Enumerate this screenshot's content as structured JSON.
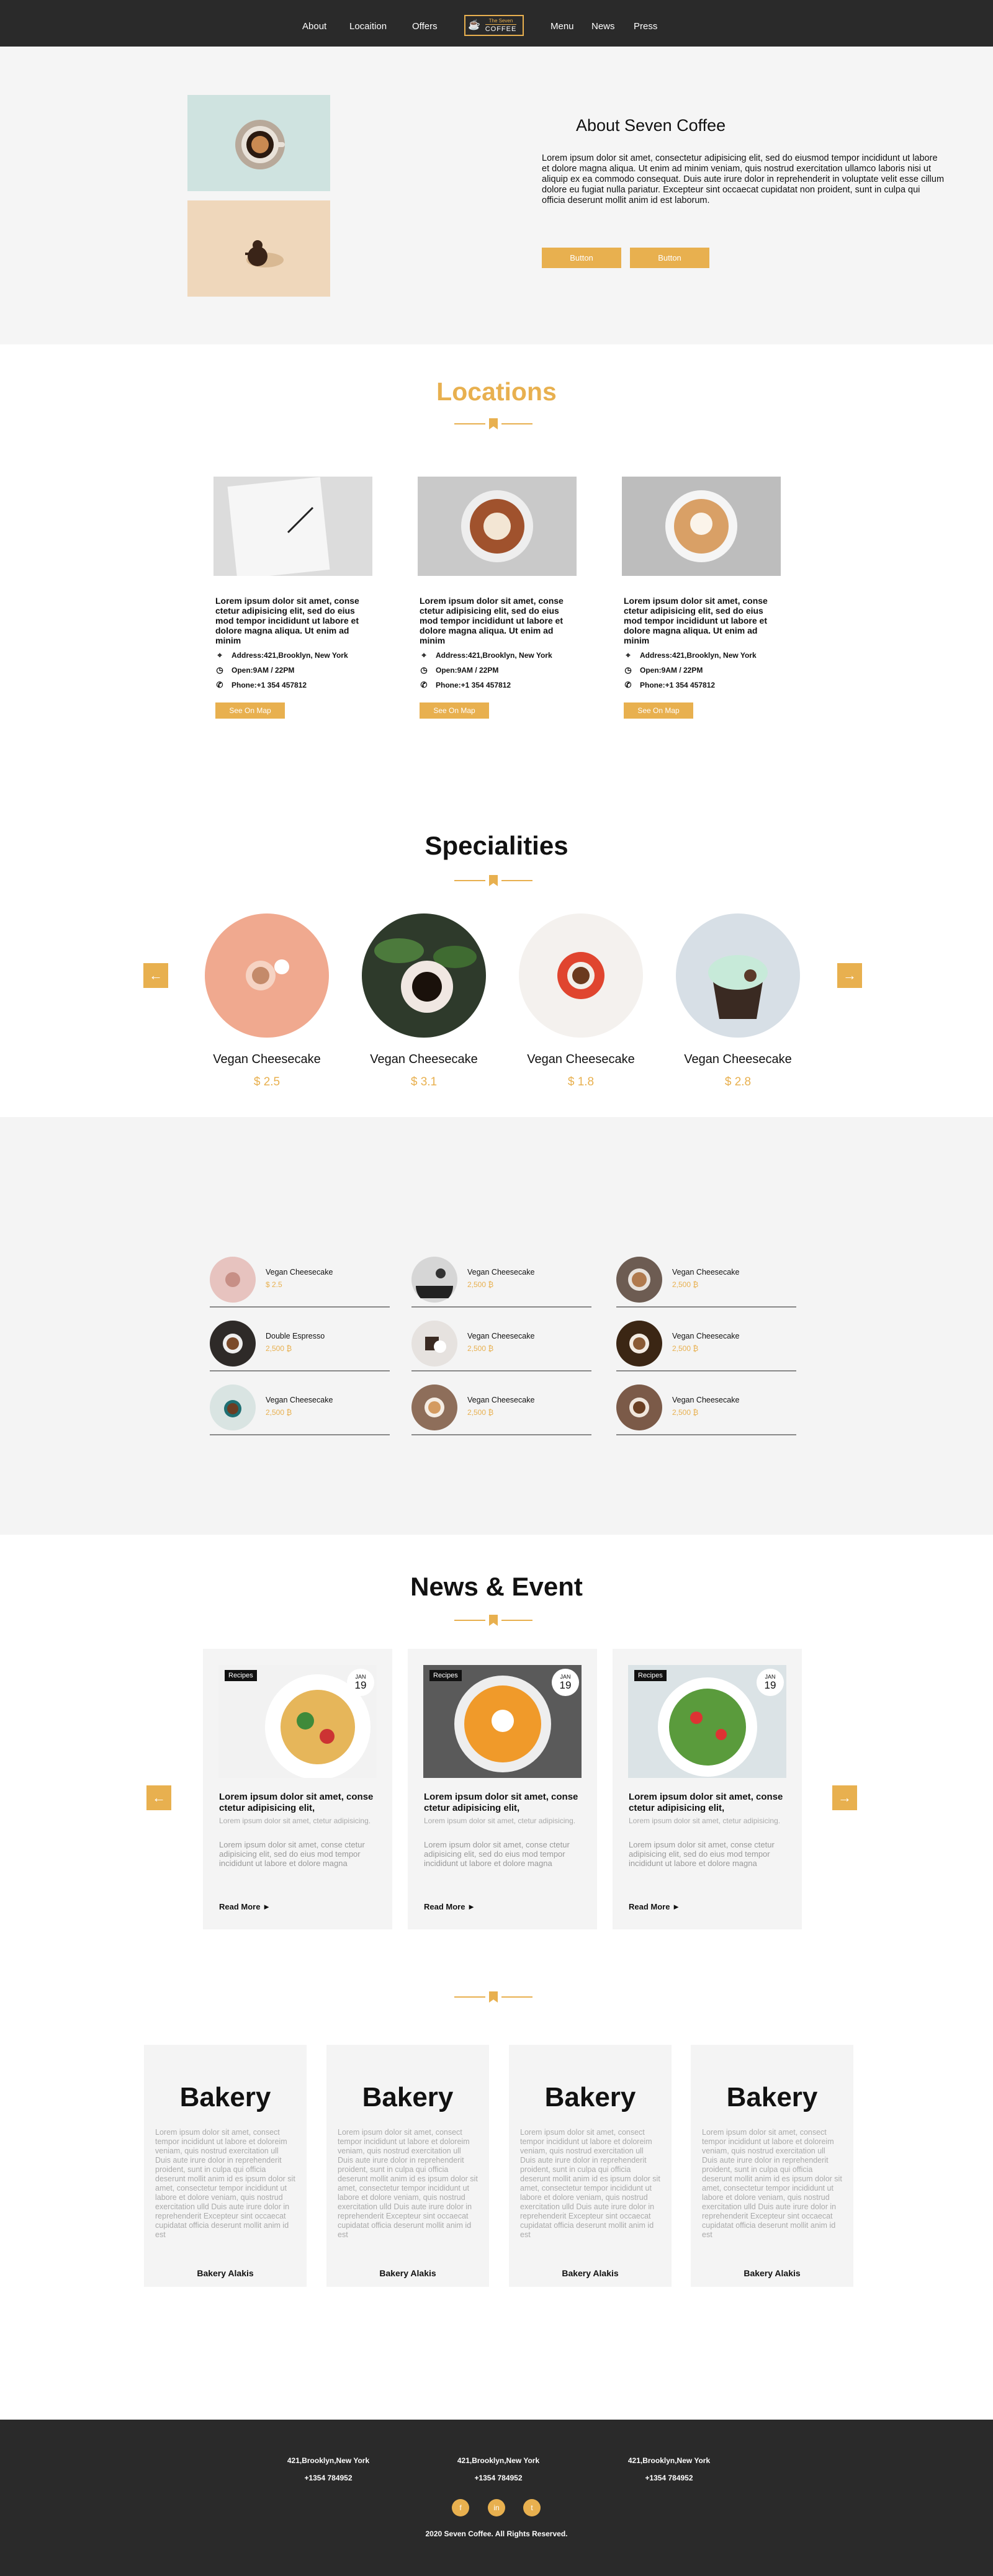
{
  "nav": {
    "links": [
      "About",
      "Locaition",
      "Offers",
      "Menu",
      "News",
      "Press"
    ],
    "logo_top": "The Seven",
    "logo_bottom": "COFFEE"
  },
  "about": {
    "title": "About Seven Coffee",
    "text": "Lorem ipsum dolor sit amet, consectetur adipisicing elit, sed do eiusmod tempor incididunt ut labore et dolore magna aliqua. Ut enim ad minim veniam, quis nostrud exercitation ullamco laboris nisi ut aliquip ex ea commodo consequat. Duis aute irure dolor in reprehenderit in voluptate velit esse cillum dolore eu fugiat nulla pariatur. Excepteur sint occaecat cupidatat non proident, sunt in culpa qui officia deserunt mollit anim id est laborum.",
    "button1": "Button",
    "button2": "Button"
  },
  "locations": {
    "title": "Locations",
    "cards": [
      {
        "desc": "Lorem ipsum dolor sit amet, conse ctetur adipisicing elit, sed do eius mod tempor incididunt ut labore  et dolore magna  aliqua. Ut enim ad minim",
        "address": "Address:421,Brooklyn, New York",
        "open": "Open:9AM / 22PM",
        "phone": "Phone:+1 354 457812",
        "map": "See On Map"
      },
      {
        "desc": "Lorem ipsum dolor sit amet, conse ctetur adipisicing elit, sed do eius mod tempor incididunt ut labore  et dolore magna  aliqua. Ut enim ad minim",
        "address": "Address:421,Brooklyn, New York",
        "open": "Open:9AM / 22PM",
        "phone": "Phone:+1 354 457812",
        "map": "See On Map"
      },
      {
        "desc": "Lorem ipsum dolor sit amet, conse ctetur adipisicing elit, sed do eius mod tempor incididunt ut labore  et dolore magna  aliqua. Ut enim ad minim",
        "address": "Address:421,Brooklyn, New York",
        "open": "Open:9AM / 22PM",
        "phone": "Phone:+1 354 457812",
        "map": "See On Map"
      }
    ]
  },
  "specialities": {
    "title": "Specialities",
    "items": [
      {
        "name": "Vegan Cheesecake",
        "price": "$ 2.5"
      },
      {
        "name": "Vegan Cheesecake",
        "price": "$ 3.1"
      },
      {
        "name": "Vegan Cheesecake",
        "price": "$ 1.8"
      },
      {
        "name": "Vegan Cheesecake",
        "price": "$ 2.8"
      }
    ]
  },
  "menu": {
    "items": [
      {
        "name": "Vegan Cheesecake",
        "price": "$ 2.5"
      },
      {
        "name": "Vegan Cheesecake",
        "price": "2,500 ₿"
      },
      {
        "name": "Vegan Cheesecake",
        "price": "2,500 ₿"
      },
      {
        "name": "Double Espresso",
        "price": "2,500 ₿"
      },
      {
        "name": "Vegan Cheesecake",
        "price": "2,500 ₿"
      },
      {
        "name": "Vegan Cheesecake",
        "price": "2,500 ₿"
      },
      {
        "name": "Vegan Cheesecake",
        "price": "2,500 ₿"
      },
      {
        "name": "Vegan Cheesecake",
        "price": "2,500 ₿"
      },
      {
        "name": "Vegan Cheesecake",
        "price": "2,500 ₿"
      }
    ]
  },
  "news": {
    "title": "News & Event",
    "cards": [
      {
        "tag": "Recipes",
        "month": "JAN",
        "day": "19",
        "heading": "Lorem ipsum dolor sit amet, conse ctetur adipisicing elit,",
        "sub": "Lorem ipsum dolor sit amet, ctetur adipisicing.",
        "body": "Lorem ipsum dolor sit amet, conse ctetur adipisicing elit, sed do eius mod tempor incididunt ut labore  et dolore magna",
        "read_more": "Read More  ►"
      },
      {
        "tag": "Recipes",
        "month": "JAN",
        "day": "19",
        "heading": "Lorem ipsum dolor sit amet, conse ctetur adipisicing elit,",
        "sub": "Lorem ipsum dolor sit amet, ctetur adipisicing.",
        "body": "Lorem ipsum dolor sit amet, conse ctetur adipisicing elit, sed do eius mod tempor incididunt ut labore  et dolore magna",
        "read_more": "Read More  ►"
      },
      {
        "tag": "Recipes",
        "month": "JAN",
        "day": "19",
        "heading": "Lorem ipsum dolor sit amet, conse ctetur adipisicing elit,",
        "sub": "Lorem ipsum dolor sit amet, ctetur adipisicing.",
        "body": "Lorem ipsum dolor sit amet, conse ctetur adipisicing elit, sed do eius mod tempor incididunt ut labore  et dolore magna",
        "read_more": "Read More  ►"
      }
    ]
  },
  "bakery": {
    "cards": [
      {
        "title": "Bakery",
        "text": "Lorem ipsum dolor sit amet, consect tempor incididunt ut labore et doloreim veniam, quis nostrud exercitation ull Duis aute irure dolor in reprehenderit proident, sunt in culpa qui officia deserunt mollit anim id es ipsum dolor sit amet, consectetur tempor incididunt ut labore et dolore veniam, quis nostrud exercitation ulld Duis aute irure dolor in reprehenderit Excepteur sint occaecat cupidatat officia deserunt mollit anim id est",
        "author": "Bakery Alakis"
      },
      {
        "title": "Bakery",
        "text": "Lorem ipsum dolor sit amet, consect tempor incididunt ut labore et doloreim veniam, quis nostrud exercitation ull Duis aute irure dolor in reprehenderit proident, sunt in culpa qui officia deserunt mollit anim id es ipsum dolor sit amet, consectetur tempor incididunt ut labore et dolore veniam, quis nostrud exercitation ulld Duis aute irure dolor in reprehenderit Excepteur sint occaecat cupidatat officia deserunt mollit anim id est",
        "author": "Bakery Alakis"
      },
      {
        "title": "Bakery",
        "text": "Lorem ipsum dolor sit amet, consect tempor incididunt ut labore et doloreim veniam, quis nostrud exercitation ull Duis aute irure dolor in reprehenderit proident, sunt in culpa qui officia deserunt mollit anim id es ipsum dolor sit amet, consectetur tempor incididunt ut labore et dolore veniam, quis nostrud exercitation ulld Duis aute irure dolor in reprehenderit Excepteur sint occaecat cupidatat officia deserunt mollit anim id est",
        "author": "Bakery Alakis"
      },
      {
        "title": "Bakery",
        "text": "Lorem ipsum dolor sit amet, consect tempor incididunt ut labore et doloreim veniam, quis nostrud exercitation ull Duis aute irure dolor in reprehenderit proident, sunt in culpa qui officia deserunt mollit anim id es ipsum dolor sit amet, consectetur tempor incididunt ut labore et dolore veniam, quis nostrud exercitation ulld Duis aute irure dolor in reprehenderit Excepteur sint occaecat cupidatat officia deserunt mollit anim id est",
        "author": "Bakery Alakis"
      }
    ]
  },
  "footer": {
    "addresses": [
      {
        "address": "421,Brooklyn,New York",
        "phone": "+1354 784952"
      },
      {
        "address": "421,Brooklyn,New York",
        "phone": "+1354 784952"
      },
      {
        "address": "421,Brooklyn,New York",
        "phone": "+1354 784952"
      }
    ],
    "social": [
      "f",
      "in",
      "t"
    ],
    "copyright": "2020 Seven Coffee. All Rights Reserved."
  },
  "colors": {
    "accent": "#e8b04f",
    "dark": "#2a2a2a",
    "light_bg": "#f4f4f4"
  }
}
